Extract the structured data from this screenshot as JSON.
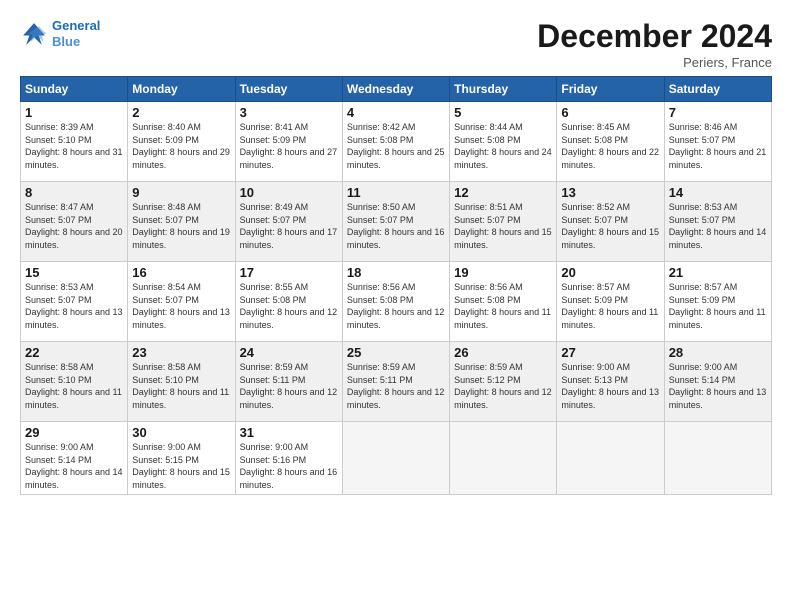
{
  "header": {
    "logo_line1": "General",
    "logo_line2": "Blue",
    "title": "December 2024",
    "location": "Periers, France"
  },
  "weekdays": [
    "Sunday",
    "Monday",
    "Tuesday",
    "Wednesday",
    "Thursday",
    "Friday",
    "Saturday"
  ],
  "weeks": [
    [
      {
        "day": 1,
        "sunrise": "8:39 AM",
        "sunset": "5:10 PM",
        "daylight": "8 hours and 31 minutes"
      },
      {
        "day": 2,
        "sunrise": "8:40 AM",
        "sunset": "5:09 PM",
        "daylight": "8 hours and 29 minutes"
      },
      {
        "day": 3,
        "sunrise": "8:41 AM",
        "sunset": "5:09 PM",
        "daylight": "8 hours and 27 minutes"
      },
      {
        "day": 4,
        "sunrise": "8:42 AM",
        "sunset": "5:08 PM",
        "daylight": "8 hours and 25 minutes"
      },
      {
        "day": 5,
        "sunrise": "8:44 AM",
        "sunset": "5:08 PM",
        "daylight": "8 hours and 24 minutes"
      },
      {
        "day": 6,
        "sunrise": "8:45 AM",
        "sunset": "5:08 PM",
        "daylight": "8 hours and 22 minutes"
      },
      {
        "day": 7,
        "sunrise": "8:46 AM",
        "sunset": "5:07 PM",
        "daylight": "8 hours and 21 minutes"
      }
    ],
    [
      {
        "day": 8,
        "sunrise": "8:47 AM",
        "sunset": "5:07 PM",
        "daylight": "8 hours and 20 minutes"
      },
      {
        "day": 9,
        "sunrise": "8:48 AM",
        "sunset": "5:07 PM",
        "daylight": "8 hours and 19 minutes"
      },
      {
        "day": 10,
        "sunrise": "8:49 AM",
        "sunset": "5:07 PM",
        "daylight": "8 hours and 17 minutes"
      },
      {
        "day": 11,
        "sunrise": "8:50 AM",
        "sunset": "5:07 PM",
        "daylight": "8 hours and 16 minutes"
      },
      {
        "day": 12,
        "sunrise": "8:51 AM",
        "sunset": "5:07 PM",
        "daylight": "8 hours and 15 minutes"
      },
      {
        "day": 13,
        "sunrise": "8:52 AM",
        "sunset": "5:07 PM",
        "daylight": "8 hours and 15 minutes"
      },
      {
        "day": 14,
        "sunrise": "8:53 AM",
        "sunset": "5:07 PM",
        "daylight": "8 hours and 14 minutes"
      }
    ],
    [
      {
        "day": 15,
        "sunrise": "8:53 AM",
        "sunset": "5:07 PM",
        "daylight": "8 hours and 13 minutes"
      },
      {
        "day": 16,
        "sunrise": "8:54 AM",
        "sunset": "5:07 PM",
        "daylight": "8 hours and 13 minutes"
      },
      {
        "day": 17,
        "sunrise": "8:55 AM",
        "sunset": "5:08 PM",
        "daylight": "8 hours and 12 minutes"
      },
      {
        "day": 18,
        "sunrise": "8:56 AM",
        "sunset": "5:08 PM",
        "daylight": "8 hours and 12 minutes"
      },
      {
        "day": 19,
        "sunrise": "8:56 AM",
        "sunset": "5:08 PM",
        "daylight": "8 hours and 11 minutes"
      },
      {
        "day": 20,
        "sunrise": "8:57 AM",
        "sunset": "5:09 PM",
        "daylight": "8 hours and 11 minutes"
      },
      {
        "day": 21,
        "sunrise": "8:57 AM",
        "sunset": "5:09 PM",
        "daylight": "8 hours and 11 minutes"
      }
    ],
    [
      {
        "day": 22,
        "sunrise": "8:58 AM",
        "sunset": "5:10 PM",
        "daylight": "8 hours and 11 minutes"
      },
      {
        "day": 23,
        "sunrise": "8:58 AM",
        "sunset": "5:10 PM",
        "daylight": "8 hours and 11 minutes"
      },
      {
        "day": 24,
        "sunrise": "8:59 AM",
        "sunset": "5:11 PM",
        "daylight": "8 hours and 12 minutes"
      },
      {
        "day": 25,
        "sunrise": "8:59 AM",
        "sunset": "5:11 PM",
        "daylight": "8 hours and 12 minutes"
      },
      {
        "day": 26,
        "sunrise": "8:59 AM",
        "sunset": "5:12 PM",
        "daylight": "8 hours and 12 minutes"
      },
      {
        "day": 27,
        "sunrise": "9:00 AM",
        "sunset": "5:13 PM",
        "daylight": "8 hours and 13 minutes"
      },
      {
        "day": 28,
        "sunrise": "9:00 AM",
        "sunset": "5:14 PM",
        "daylight": "8 hours and 13 minutes"
      }
    ],
    [
      {
        "day": 29,
        "sunrise": "9:00 AM",
        "sunset": "5:14 PM",
        "daylight": "8 hours and 14 minutes"
      },
      {
        "day": 30,
        "sunrise": "9:00 AM",
        "sunset": "5:15 PM",
        "daylight": "8 hours and 15 minutes"
      },
      {
        "day": 31,
        "sunrise": "9:00 AM",
        "sunset": "5:16 PM",
        "daylight": "8 hours and 16 minutes"
      },
      null,
      null,
      null,
      null
    ]
  ]
}
